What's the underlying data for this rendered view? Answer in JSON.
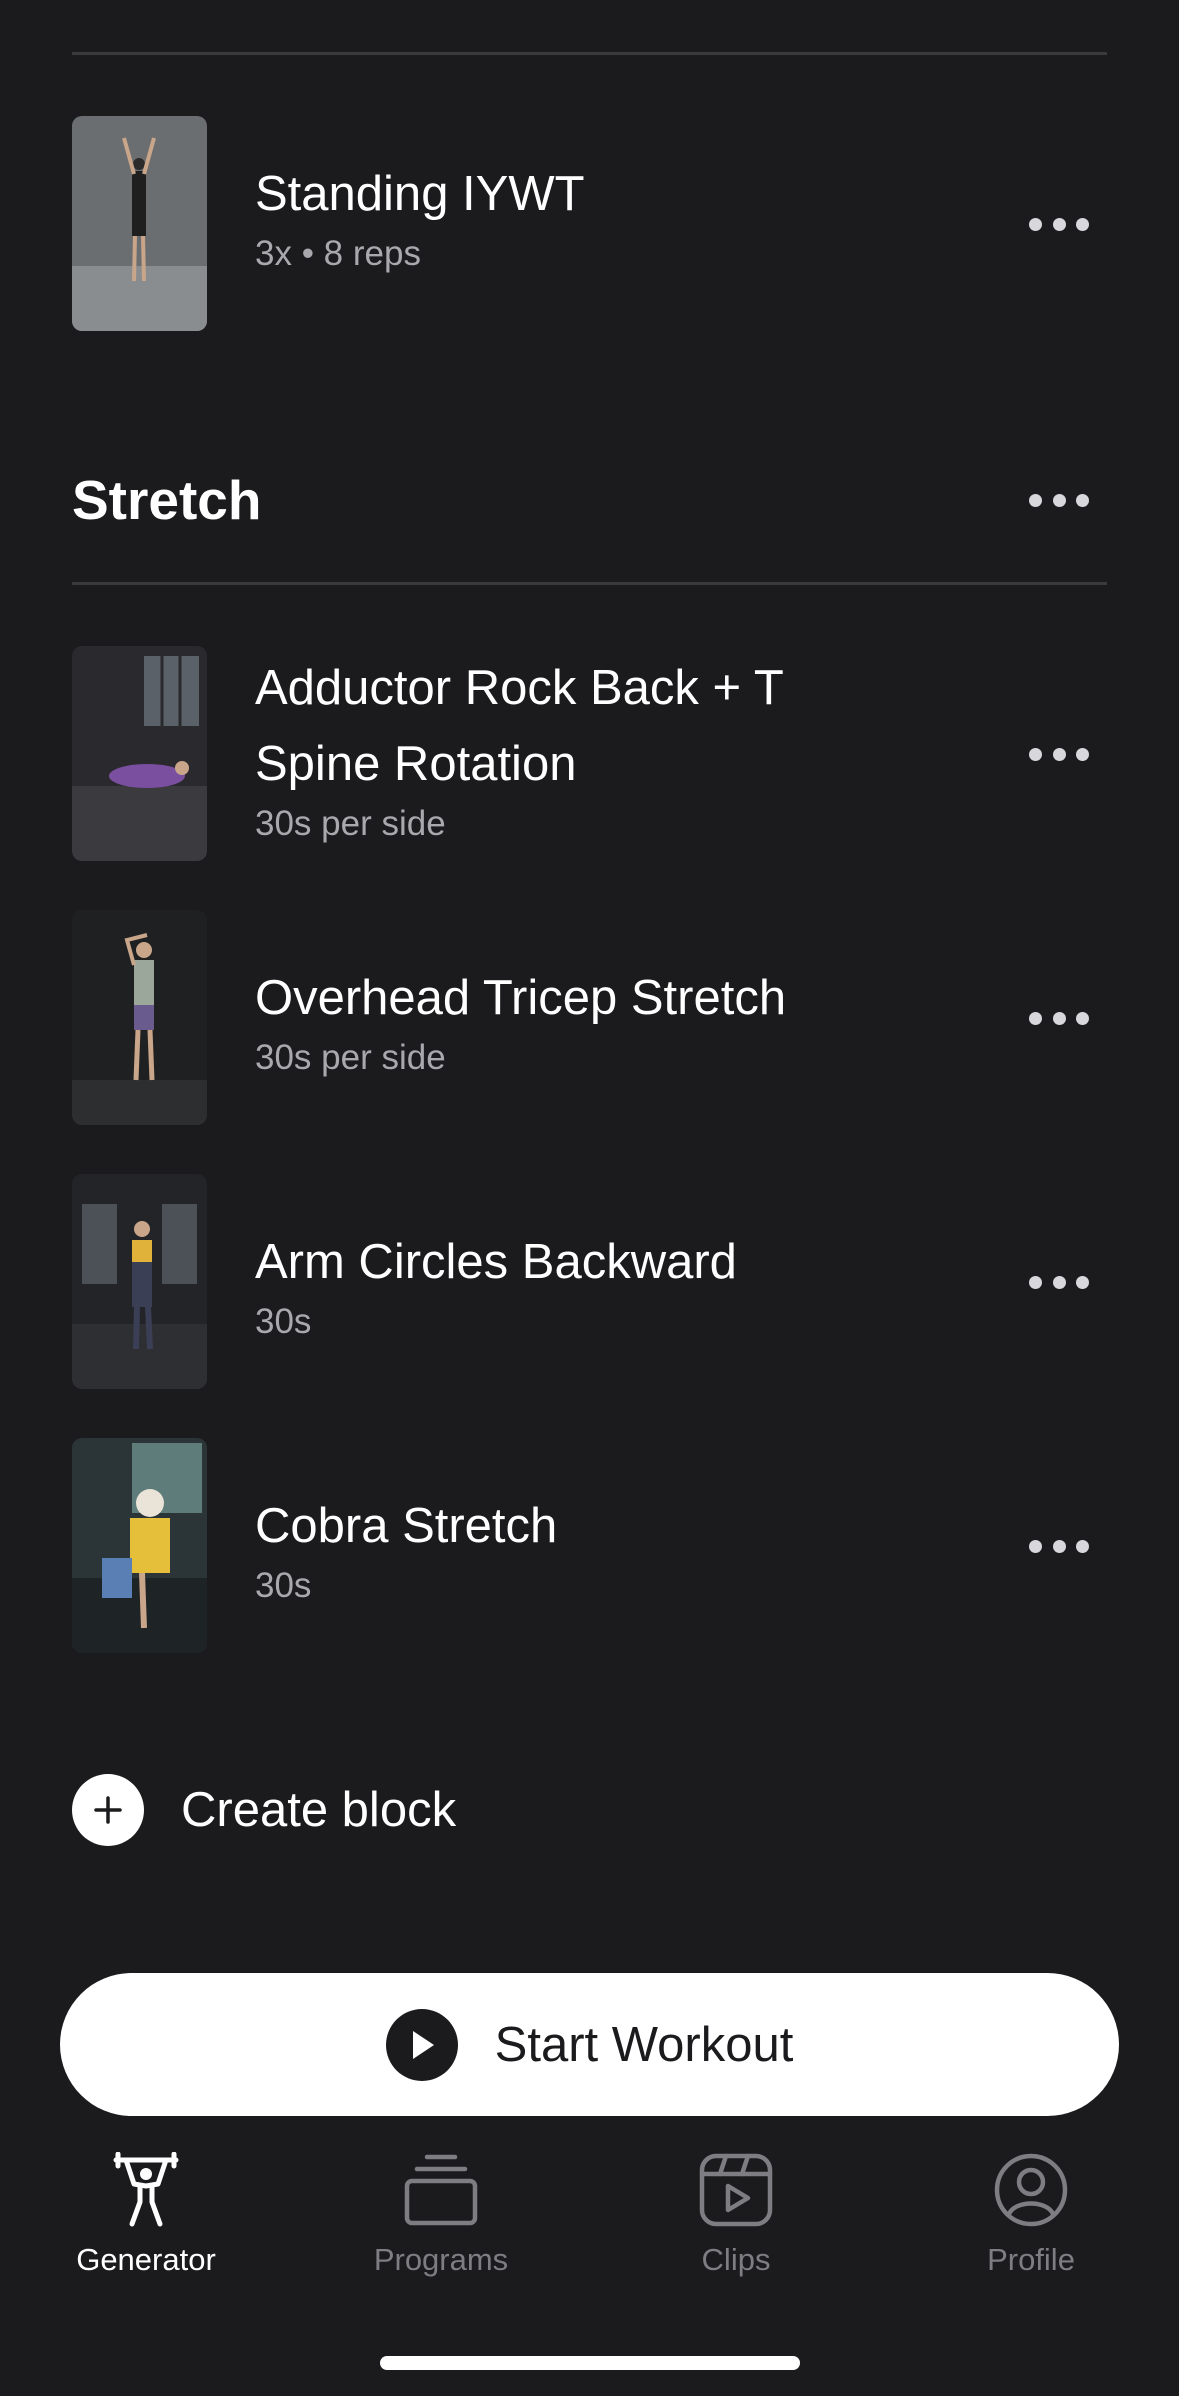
{
  "colors": {
    "background": "#1b1b1d",
    "text_primary": "#ffffff",
    "text_secondary": "#a8a8ad",
    "tab_inactive": "#7d7d82",
    "divider": "#3a3a3d"
  },
  "previous_section": {
    "exercises": [
      {
        "name": "Standing IYWT",
        "detail": "3x • 8 reps",
        "more_icon": "ellipsis-icon"
      }
    ]
  },
  "stretch_section": {
    "title": "Stretch",
    "more_icon": "ellipsis-icon",
    "exercises": [
      {
        "name": "Adductor Rock Back + T Spine Rotation",
        "detail": "30s per side"
      },
      {
        "name": "Overhead Tricep Stretch",
        "detail": "30s per side"
      },
      {
        "name": "Arm Circles Backward",
        "detail": "30s"
      },
      {
        "name": "Cobra Stretch",
        "detail": "30s"
      }
    ]
  },
  "create_block": {
    "label": "Create block",
    "icon": "plus-icon"
  },
  "start_button": {
    "label": "Start Workout",
    "icon": "play-icon"
  },
  "tabbar": {
    "tabs": [
      {
        "label": "Generator",
        "icon": "weightlifter-icon",
        "active": true
      },
      {
        "label": "Programs",
        "icon": "stack-icon",
        "active": false
      },
      {
        "label": "Clips",
        "icon": "video-clip-icon",
        "active": false
      },
      {
        "label": "Profile",
        "icon": "profile-icon",
        "active": false
      }
    ]
  }
}
